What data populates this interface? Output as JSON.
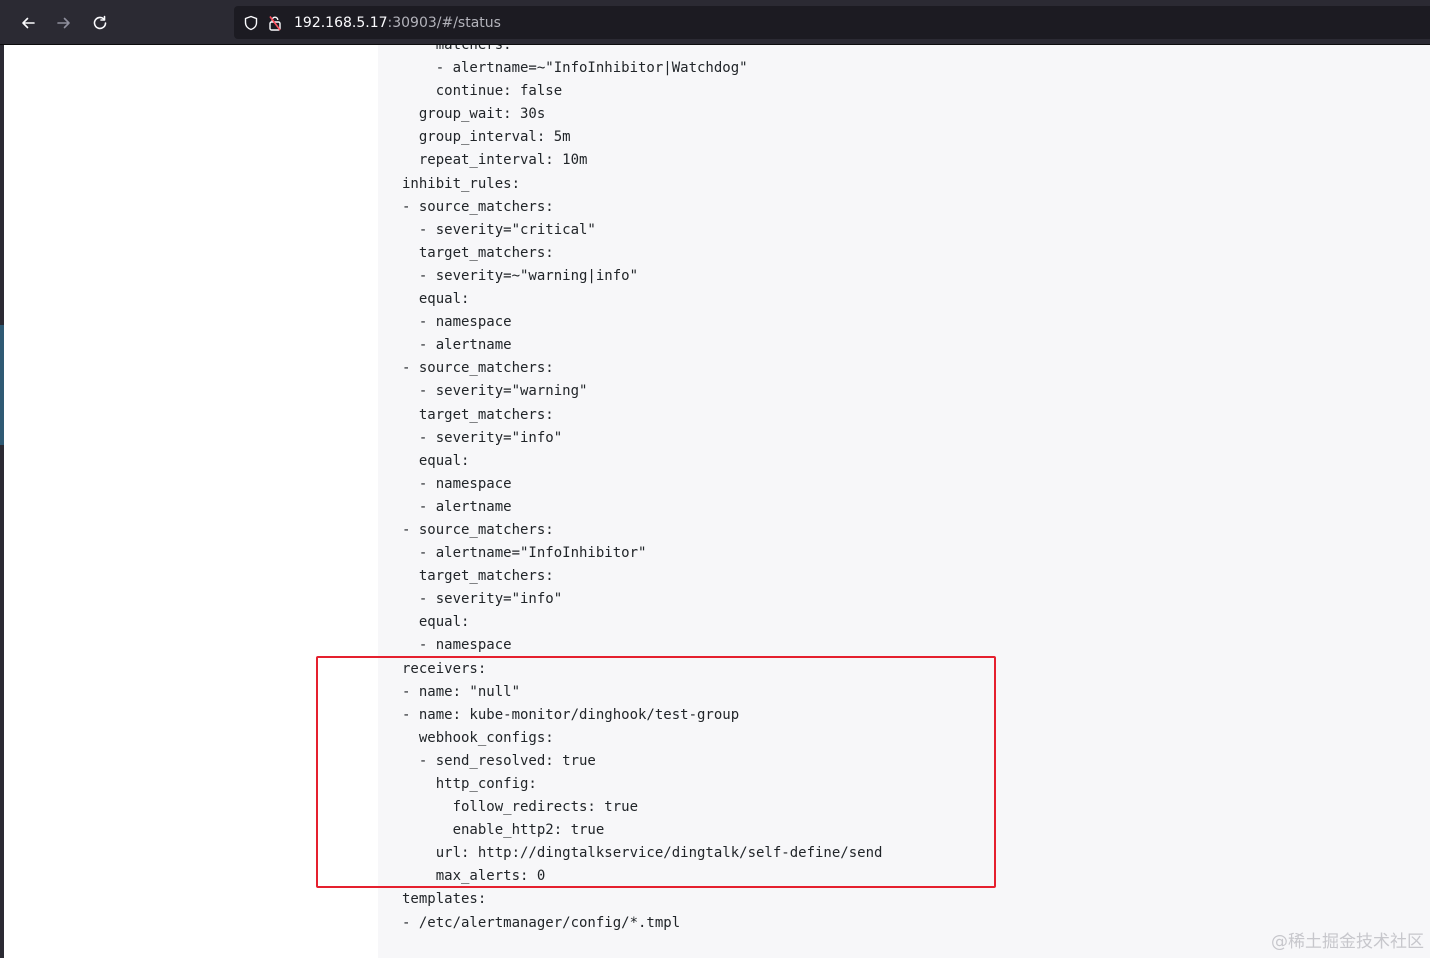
{
  "browser": {
    "back_icon": "arrow-left-icon",
    "forward_icon": "arrow-right-icon",
    "reload_icon": "reload-icon",
    "tracking_icon": "shield-icon",
    "security_icon": "lock-warning-icon",
    "url_host": "192.168.5.17",
    "url_path": ":30903/#/status"
  },
  "config_lines": [
    "    matchers:",
    "    - alertname=~\"InfoInhibitor|Watchdog\"",
    "    continue: false",
    "  group_wait: 30s",
    "  group_interval: 5m",
    "  repeat_interval: 10m",
    "inhibit_rules:",
    "- source_matchers:",
    "  - severity=\"critical\"",
    "  target_matchers:",
    "  - severity=~\"warning|info\"",
    "  equal:",
    "  - namespace",
    "  - alertname",
    "- source_matchers:",
    "  - severity=\"warning\"",
    "  target_matchers:",
    "  - severity=\"info\"",
    "  equal:",
    "  - namespace",
    "  - alertname",
    "- source_matchers:",
    "  - alertname=\"InfoInhibitor\"",
    "  target_matchers:",
    "  - severity=\"info\"",
    "  equal:",
    "  - namespace",
    "receivers:",
    "- name: \"null\"",
    "- name: kube-monitor/dinghook/test-group",
    "  webhook_configs:",
    "  - send_resolved: true",
    "    http_config:",
    "      follow_redirects: true",
    "      enable_http2: true",
    "    url: http://dingtalkservice/dingtalk/self-define/send",
    "    max_alerts: 0",
    "templates:",
    "- /etc/alertmanager/config/*.tmpl"
  ],
  "highlight_color": "#e5202e",
  "watermark": "@稀土掘金技术社区"
}
